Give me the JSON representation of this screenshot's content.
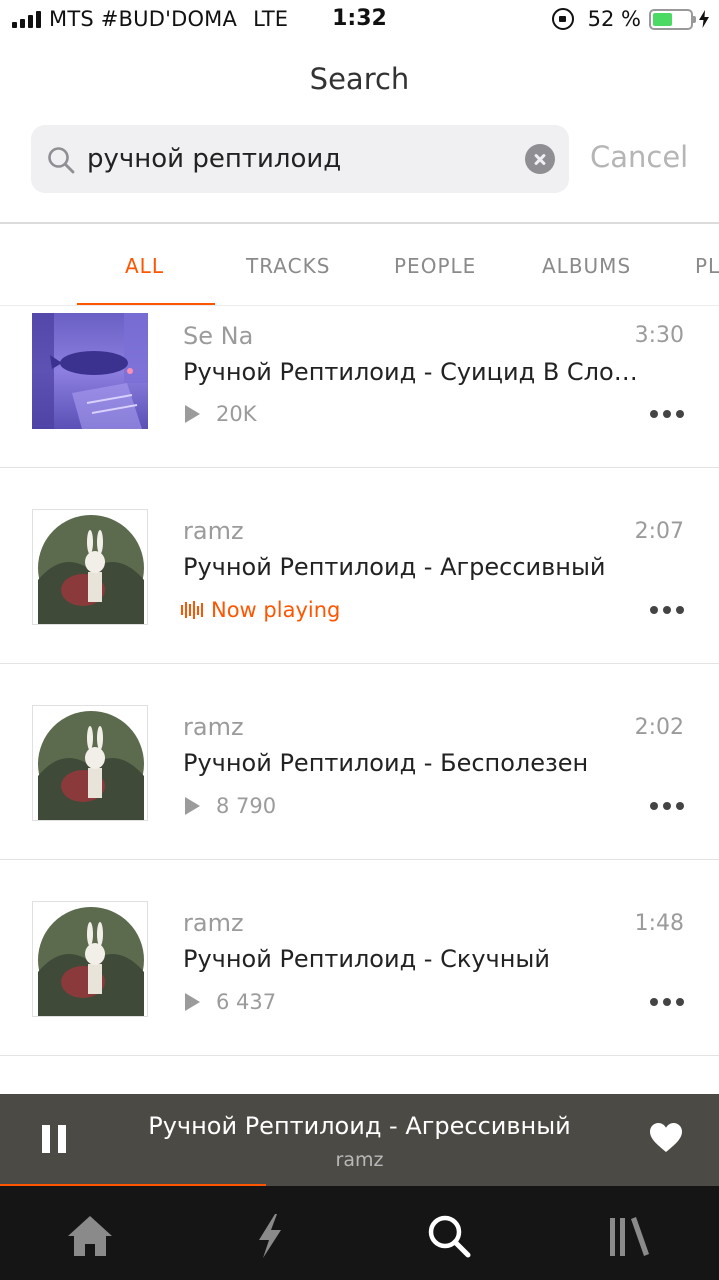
{
  "status_bar": {
    "carrier": "MTS #BUD'DOMA",
    "network": "LTE",
    "time": "1:32",
    "battery": "52 %",
    "battery_level": 0.52,
    "icons": [
      "signal-icon",
      "rotation-lock-icon",
      "battery-icon",
      "charging-bolt-icon"
    ]
  },
  "header": {
    "title": "Search"
  },
  "search": {
    "query": "ручной рептилоид",
    "cancel_label": "Cancel"
  },
  "tabs": [
    {
      "label": "ALL",
      "active": true
    },
    {
      "label": "TRACKS",
      "active": false
    },
    {
      "label": "PEOPLE",
      "active": false
    },
    {
      "label": "ALBUMS",
      "active": false
    },
    {
      "label": "PL",
      "active": false
    }
  ],
  "tracks": [
    {
      "artist": "Se Na",
      "title": "Ручной Рептилоид - Суицид В Слоу…",
      "duration": "3:30",
      "plays": "20K",
      "artwork": "whale-night-art"
    },
    {
      "artist": "ramz",
      "title": "Ручной Рептилоид - Агрессивный",
      "duration": "2:07",
      "status": "Now playing",
      "artwork": "bunny-octopus-art"
    },
    {
      "artist": "ramz",
      "title": "Ручной Рептилоид - Бесполезен",
      "duration": "2:02",
      "plays": "8 790",
      "artwork": "bunny-octopus-art"
    },
    {
      "artist": "ramz",
      "title": "Ручной Рептилоид - Скучный",
      "duration": "1:48",
      "plays": "6 437",
      "artwork": "bunny-octopus-art"
    }
  ],
  "mini_player": {
    "title": "Ручной Рептилоид - Агрессивный",
    "artist": "ramz",
    "progress": 0.37
  },
  "bottom_nav": {
    "items": [
      "home-icon",
      "stream-icon",
      "search-icon",
      "library-icon"
    ],
    "active": "search-icon"
  },
  "colors": {
    "accent": "#ff5500",
    "mini_player_bg": "#4b4a45",
    "nav_bg": "#151515"
  }
}
